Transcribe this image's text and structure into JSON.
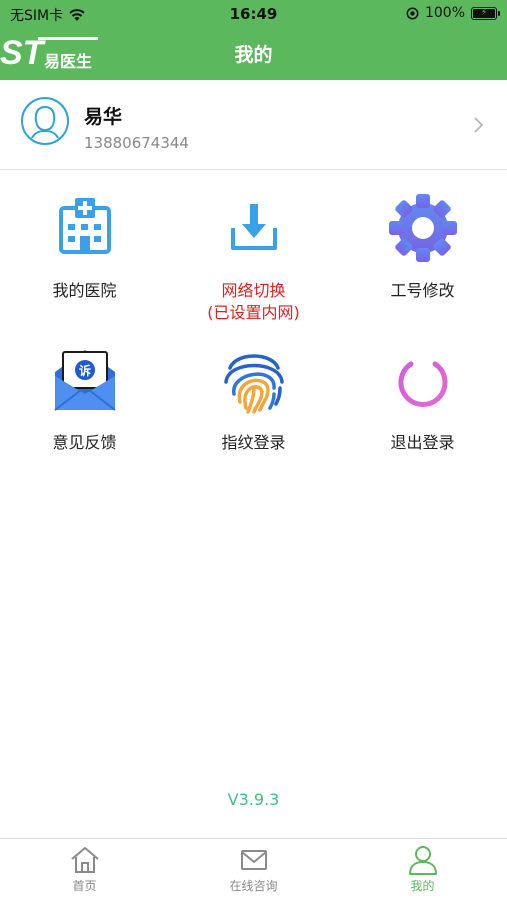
{
  "status_bar": {
    "carrier": "无SIM卡",
    "time": "16:49",
    "battery": "100%"
  },
  "header": {
    "logo_text": "ST",
    "logo_sub": "易医生",
    "title": "我的",
    "color": "#5cb85c"
  },
  "profile": {
    "name": "易华",
    "phone": "13880674344"
  },
  "menu": [
    {
      "label": "我的医院",
      "icon": "hospital-icon"
    },
    {
      "label": "网络切换",
      "sub": "(已设置内网)",
      "icon": "download-icon",
      "color": "#e0211f"
    },
    {
      "label": "工号修改",
      "icon": "gear-icon"
    },
    {
      "label": "意见反馈",
      "icon": "complaint-envelope-icon",
      "badge": "诉"
    },
    {
      "label": "指纹登录",
      "icon": "fingerprint-icon"
    },
    {
      "label": "退出登录",
      "icon": "power-icon"
    }
  ],
  "version": "V3.9.3",
  "tabs": [
    {
      "label": "首页",
      "icon": "home-icon"
    },
    {
      "label": "在线咨询",
      "icon": "mail-icon"
    },
    {
      "label": "我的",
      "icon": "user-icon",
      "active": true
    }
  ]
}
